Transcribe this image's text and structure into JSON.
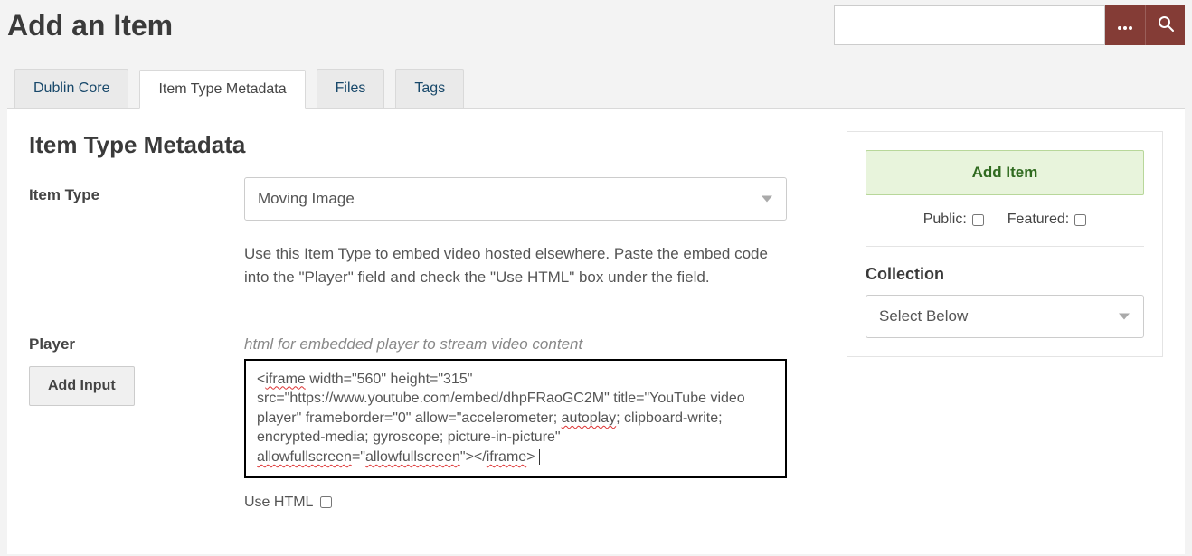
{
  "pageTitle": "Add an Item",
  "search": {
    "placeholder": ""
  },
  "tabs": {
    "dublinCore": "Dublin Core",
    "itemTypeMetadata": "Item Type Metadata",
    "files": "Files",
    "tags": "Tags"
  },
  "sectionHeading": "Item Type Metadata",
  "itemType": {
    "label": "Item Type",
    "selected": "Moving Image",
    "help": "Use this Item Type to embed video hosted elsewhere. Paste the embed code into the \"Player\" field and check the \"Use HTML\" box under the field."
  },
  "player": {
    "label": "Player",
    "help": "html for embedded player to stream video content",
    "value": "<iframe width=\"560\" height=\"315\" src=\"https://www.youtube.com/embed/dhpFRaoGC2M\" title=\"YouTube video player\" frameborder=\"0\" allow=\"accelerometer; autoplay; clipboard-write; encrypted-media; gyroscope; picture-in-picture\" allowfullscreen=\"allowfullscreen\"></iframe>",
    "useHtmlLabel": "Use HTML",
    "addInputLabel": "Add Input"
  },
  "sidebar": {
    "addItem": "Add Item",
    "publicLabel": "Public:",
    "featuredLabel": "Featured:",
    "collectionHeading": "Collection",
    "collectionSelected": "Select Below"
  }
}
